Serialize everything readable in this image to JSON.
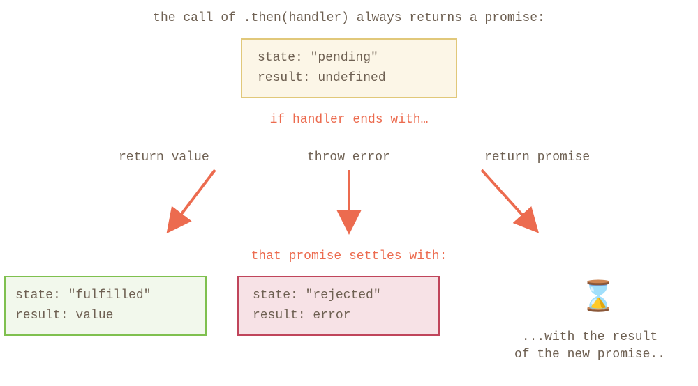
{
  "title": "the call of .then(handler) always returns a promise:",
  "pending": {
    "line1": "state: \"pending\"",
    "line2": "result: undefined"
  },
  "handler_ends": "if handler ends with…",
  "branches": {
    "return_value": "return value",
    "throw_error": "throw error",
    "return_promise": "return promise"
  },
  "settles": "that promise settles with:",
  "fulfilled": {
    "line1": "state: \"fulfilled\"",
    "line2": "result: value"
  },
  "rejected": {
    "line1": "state: \"rejected\"",
    "line2": "result: error"
  },
  "hourglass_icon": "⌛",
  "new_promise": {
    "line1": "...with the result",
    "line2": "of the new promise.."
  },
  "colors": {
    "text": "#6e6052",
    "accent": "#ec6b4f",
    "pending_border": "#e1c87a",
    "pending_bg": "#fcf6e7",
    "fulfilled_border": "#7fc04f",
    "fulfilled_bg": "#f2f8ec",
    "rejected_border": "#c0455b",
    "rejected_bg": "#f7e2e6"
  }
}
